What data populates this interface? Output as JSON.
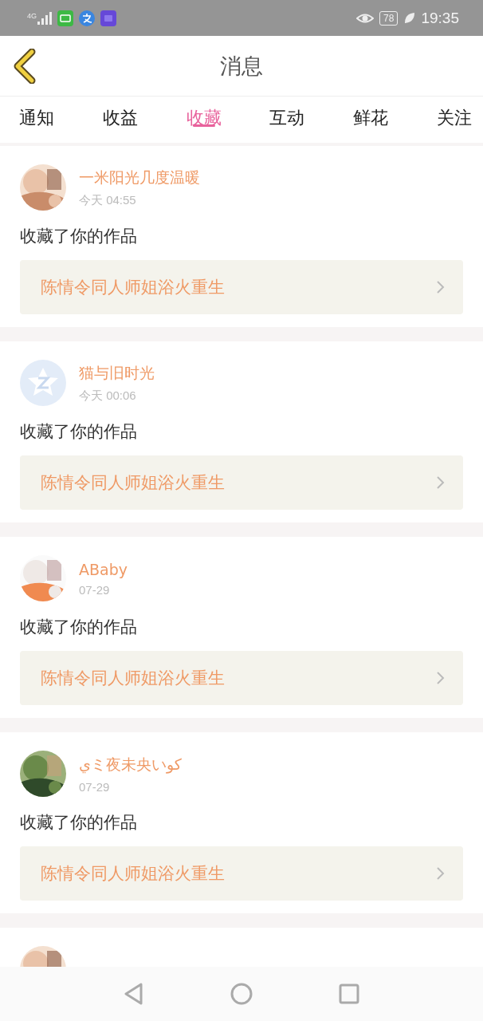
{
  "status_bar": {
    "network": "4G",
    "battery": "78",
    "time": "19:35"
  },
  "header": {
    "title": "消息"
  },
  "tabs": [
    {
      "label": "通知",
      "selected": false
    },
    {
      "label": "收益",
      "selected": false
    },
    {
      "label": "收藏",
      "selected": true
    },
    {
      "label": "互动",
      "selected": false
    },
    {
      "label": "鲜花",
      "selected": false
    },
    {
      "label": "关注",
      "selected": false
    }
  ],
  "messages": [
    {
      "user": "一米阳光几度温暖",
      "time": "今天 04:55",
      "avatar": {
        "kind": "picture"
      },
      "action": "收藏了你的作品",
      "work": "陈情令同人师姐浴火重生"
    },
    {
      "user": "猫与旧时光",
      "time": "今天 00:06",
      "avatar": {
        "kind": "default"
      },
      "action": "收藏了你的作品",
      "work": "陈情令同人师姐浴火重生"
    },
    {
      "user": "ABaby",
      "time": "07-29",
      "avatar": {
        "kind": "picture"
      },
      "action": "收藏了你的作品",
      "work": "陈情令同人师姐浴火重生"
    },
    {
      "user": "يミ夜未央いکو",
      "time": "07-29",
      "avatar": {
        "kind": "picture"
      },
      "action": "收藏了你的作品",
      "work": "陈情令同人师姐浴火重生"
    },
    {
      "avatar": {
        "kind": "picture"
      }
    }
  ]
}
